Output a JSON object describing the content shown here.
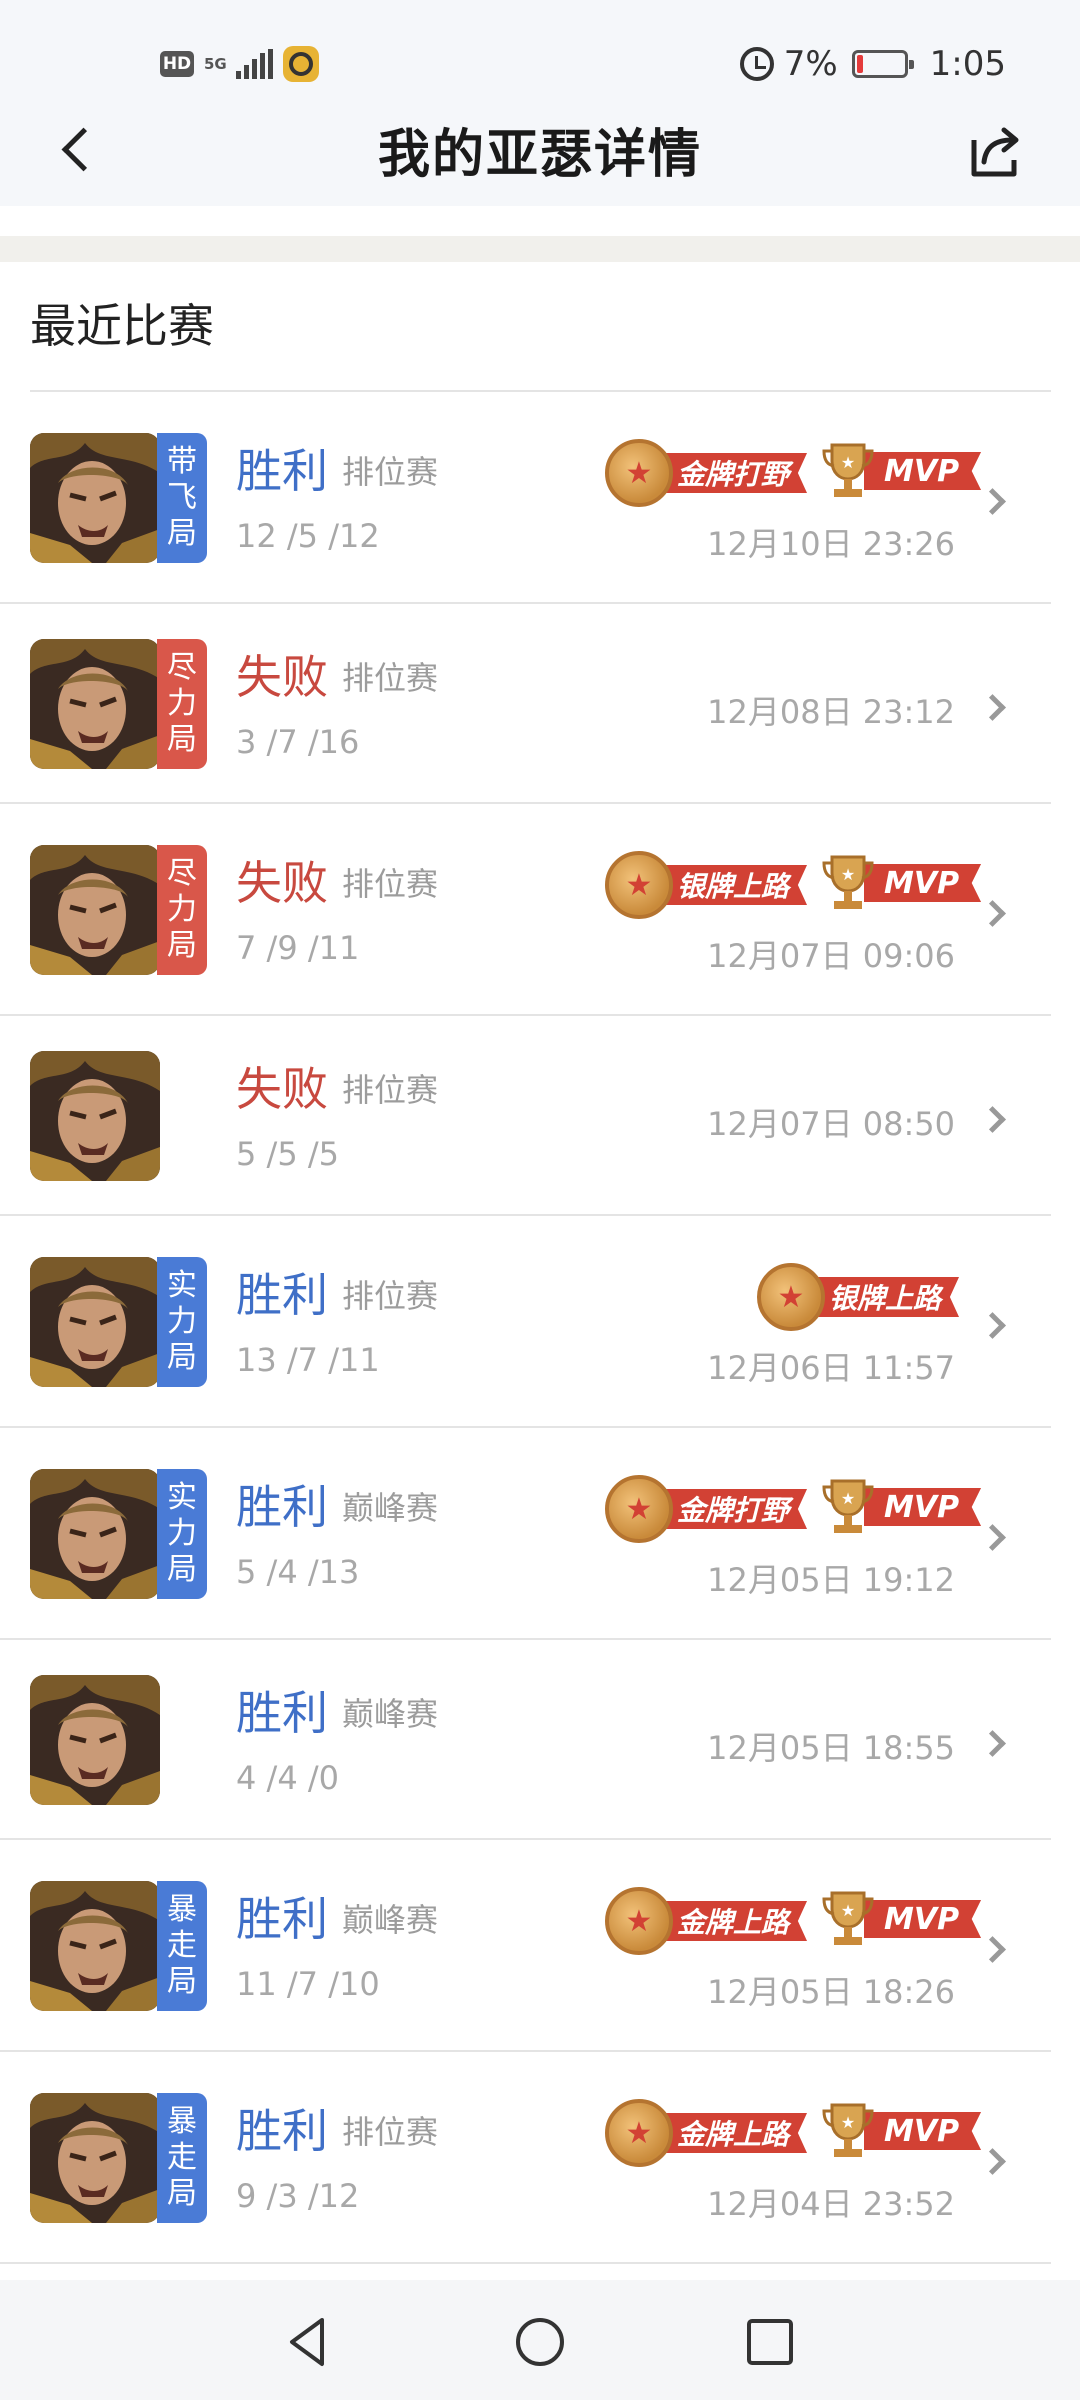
{
  "status_bar": {
    "hd": "HD",
    "network": "5G",
    "battery_percent": "7%",
    "time": "1:05"
  },
  "header": {
    "title": "我的亚瑟详情"
  },
  "section": {
    "title": "最近比赛"
  },
  "matches": [
    {
      "tier": [
        "带",
        "飞",
        "局"
      ],
      "tier_color": "blue",
      "result": "胜利",
      "mode": "排位赛",
      "kda": "12 /5 /12",
      "time": "12月10日 23:26",
      "badge": "金牌打野",
      "mvp": "MVP"
    },
    {
      "tier": [
        "尽",
        "力",
        "局"
      ],
      "tier_color": "red",
      "result": "失败",
      "mode": "排位赛",
      "kda": "3 /7 /16",
      "time": "12月08日 23:12",
      "badge": "",
      "mvp": ""
    },
    {
      "tier": [
        "尽",
        "力",
        "局"
      ],
      "tier_color": "red",
      "result": "失败",
      "mode": "排位赛",
      "kda": "7 /9 /11",
      "time": "12月07日 09:06",
      "badge": "银牌上路",
      "mvp": "MVP"
    },
    {
      "tier": [],
      "tier_color": "",
      "result": "失败",
      "mode": "排位赛",
      "kda": "5 /5 /5",
      "time": "12月07日 08:50",
      "badge": "",
      "mvp": ""
    },
    {
      "tier": [
        "实",
        "力",
        "局"
      ],
      "tier_color": "blue",
      "result": "胜利",
      "mode": "排位赛",
      "kda": "13 /7 /11",
      "time": "12月06日 11:57",
      "badge": "银牌上路",
      "mvp": ""
    },
    {
      "tier": [
        "实",
        "力",
        "局"
      ],
      "tier_color": "blue",
      "result": "胜利",
      "mode": "巅峰赛",
      "kda": "5 /4 /13",
      "time": "12月05日 19:12",
      "badge": "金牌打野",
      "mvp": "MVP"
    },
    {
      "tier": [],
      "tier_color": "",
      "result": "胜利",
      "mode": "巅峰赛",
      "kda": "4 /4 /0",
      "time": "12月05日 18:55",
      "badge": "",
      "mvp": ""
    },
    {
      "tier": [
        "暴",
        "走",
        "局"
      ],
      "tier_color": "blue",
      "result": "胜利",
      "mode": "巅峰赛",
      "kda": "11 /7 /10",
      "time": "12月05日 18:26",
      "badge": "金牌上路",
      "mvp": "MVP"
    },
    {
      "tier": [
        "暴",
        "走",
        "局"
      ],
      "tier_color": "blue",
      "result": "胜利",
      "mode": "排位赛",
      "kda": "9 /3 /12",
      "time": "12月04日 23:52",
      "badge": "金牌上路",
      "mvp": "MVP"
    }
  ]
}
